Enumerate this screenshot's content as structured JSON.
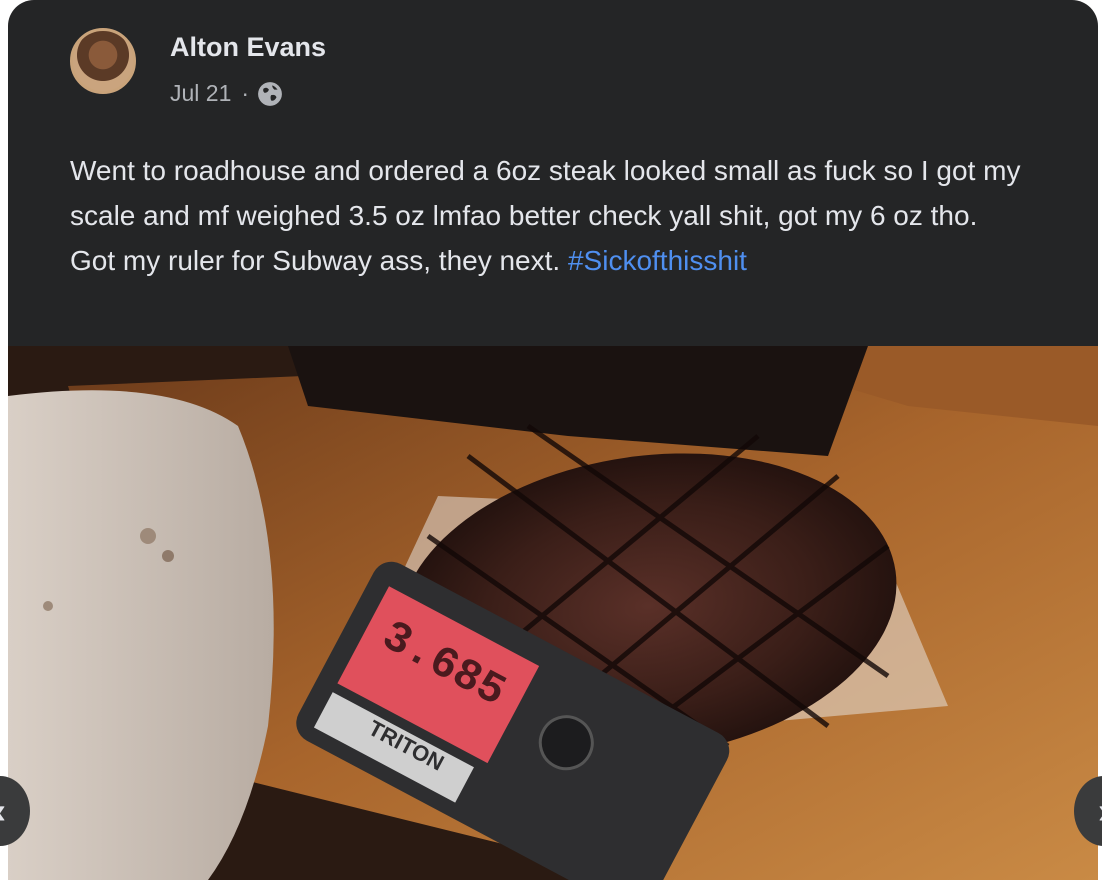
{
  "post": {
    "author": "Alton Evans",
    "date": "Jul 21",
    "separator": "·",
    "privacy_icon": "globe-icon",
    "text": "Went to roadhouse and ordered a 6oz steak looked small as fuck so I got my scale and mf weighed 3.5 oz lmfao better check yall shit, got my 6 oz tho. Got my ruler for Subway ass, they next. ",
    "hashtag": "#Sickofthisshit"
  },
  "photo": {
    "scale_brand": "TRITON",
    "scale_reading": "3.685"
  },
  "navigation": {
    "prev_icon": "chevron-left-icon",
    "next_icon": "chevron-right-icon"
  },
  "colors": {
    "card_bg": "#242526",
    "text": "#e4e6eb",
    "secondary_text": "#b0b3b8",
    "hashtag": "#4f8ff0"
  }
}
